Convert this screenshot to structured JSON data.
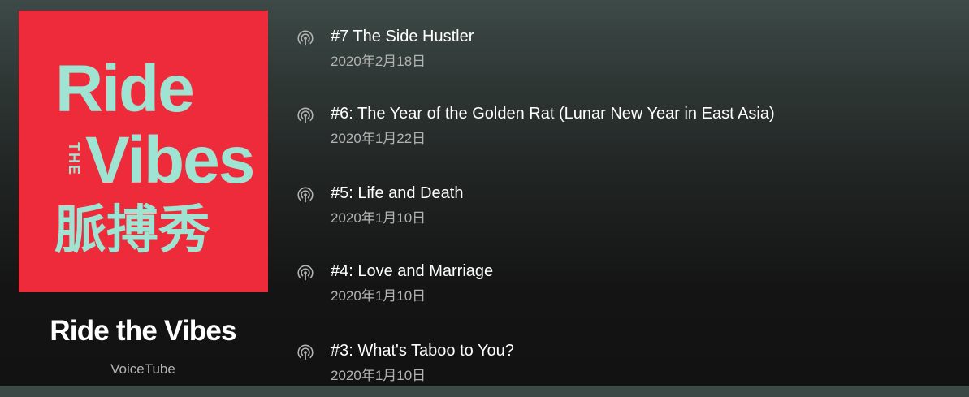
{
  "show": {
    "cover": {
      "line1": "Ride",
      "the": "THE",
      "line2": "Vibes",
      "chinese": "脈搏秀",
      "background": "#ee2b3a",
      "text_color": "#9fe3d3"
    },
    "title": "Ride the Vibes",
    "publisher": "VoiceTube"
  },
  "episodes": [
    {
      "title": "#7 The Side Hustler",
      "date": "2020年2月18日",
      "icon": "podcast-icon"
    },
    {
      "title": "#6: The Year of the Golden Rat (Lunar New Year in East Asia)",
      "date": "2020年1月22日",
      "icon": "podcast-icon"
    },
    {
      "title": "#5: Life and Death",
      "date": "2020年1月10日",
      "icon": "podcast-icon"
    },
    {
      "title": "#4: Love and Marriage",
      "date": "2020年1月10日",
      "icon": "podcast-icon"
    },
    {
      "title": "#3: What's Taboo to You?",
      "date": "2020年1月10日",
      "icon": "podcast-icon"
    }
  ],
  "colors": {
    "primary_text": "#ffffff",
    "secondary_text": "#b3b3b3",
    "background_top": "#3d4a47",
    "background_bottom": "#121212"
  }
}
